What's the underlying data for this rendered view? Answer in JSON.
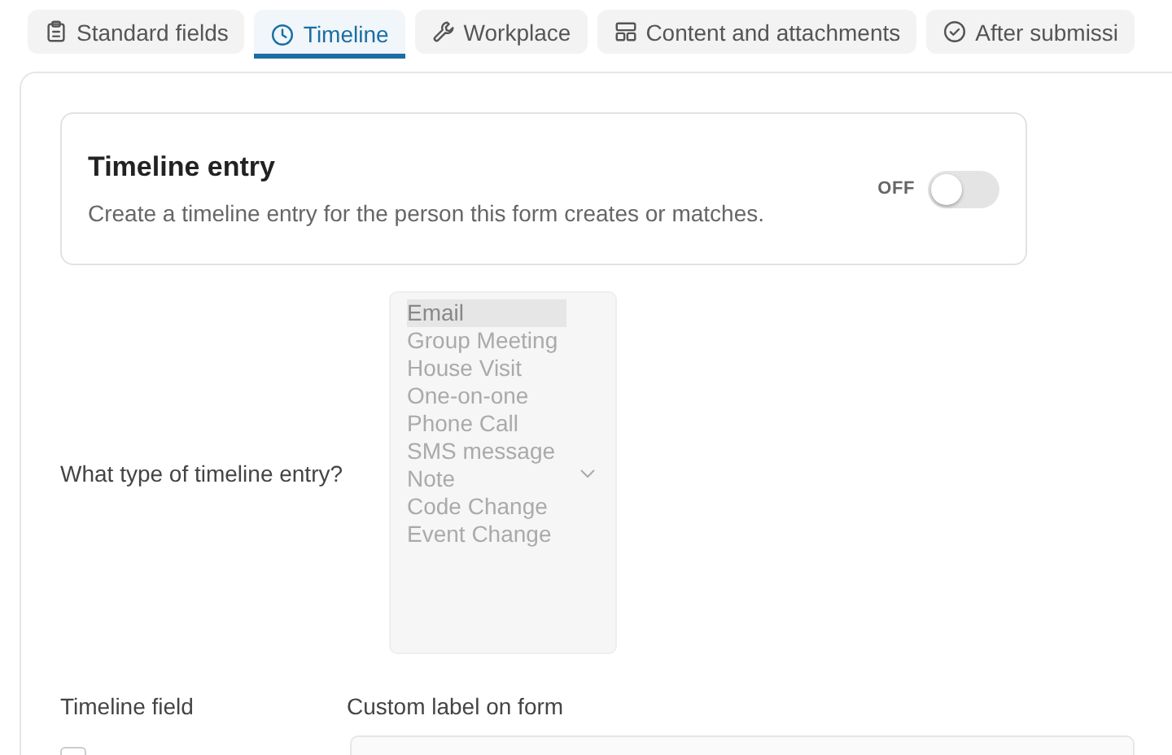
{
  "tabs": [
    {
      "label": "Standard fields",
      "kind": "clipboard",
      "selected": false
    },
    {
      "label": "Timeline",
      "kind": "clock",
      "selected": true
    },
    {
      "label": "Workplace",
      "kind": "wrench",
      "selected": false
    },
    {
      "label": "Content and attachments",
      "kind": "layout",
      "selected": false
    },
    {
      "label": "After submissi",
      "kind": "check-circle",
      "selected": false
    }
  ],
  "card": {
    "title": "Timeline entry",
    "description": "Create a timeline entry for the person this form creates or matches.",
    "toggle_label": "OFF",
    "on": false
  },
  "entry_type": {
    "label": "What type of timeline entry?",
    "disabled": true,
    "options": [
      {
        "label": "Email",
        "selected": true
      },
      {
        "label": "Group Meeting",
        "selected": false
      },
      {
        "label": "House Visit",
        "selected": false
      },
      {
        "label": "One-on-one",
        "selected": false
      },
      {
        "label": "Phone Call",
        "selected": false
      },
      {
        "label": "SMS message",
        "selected": false
      },
      {
        "label": "Note",
        "selected": false
      },
      {
        "label": "Code Change",
        "selected": false
      },
      {
        "label": "Event Change",
        "selected": false
      }
    ]
  },
  "fields_header": {
    "column_1": "Timeline field",
    "column_2": "Custom label on form"
  },
  "field_row": {
    "checked": false
  }
}
